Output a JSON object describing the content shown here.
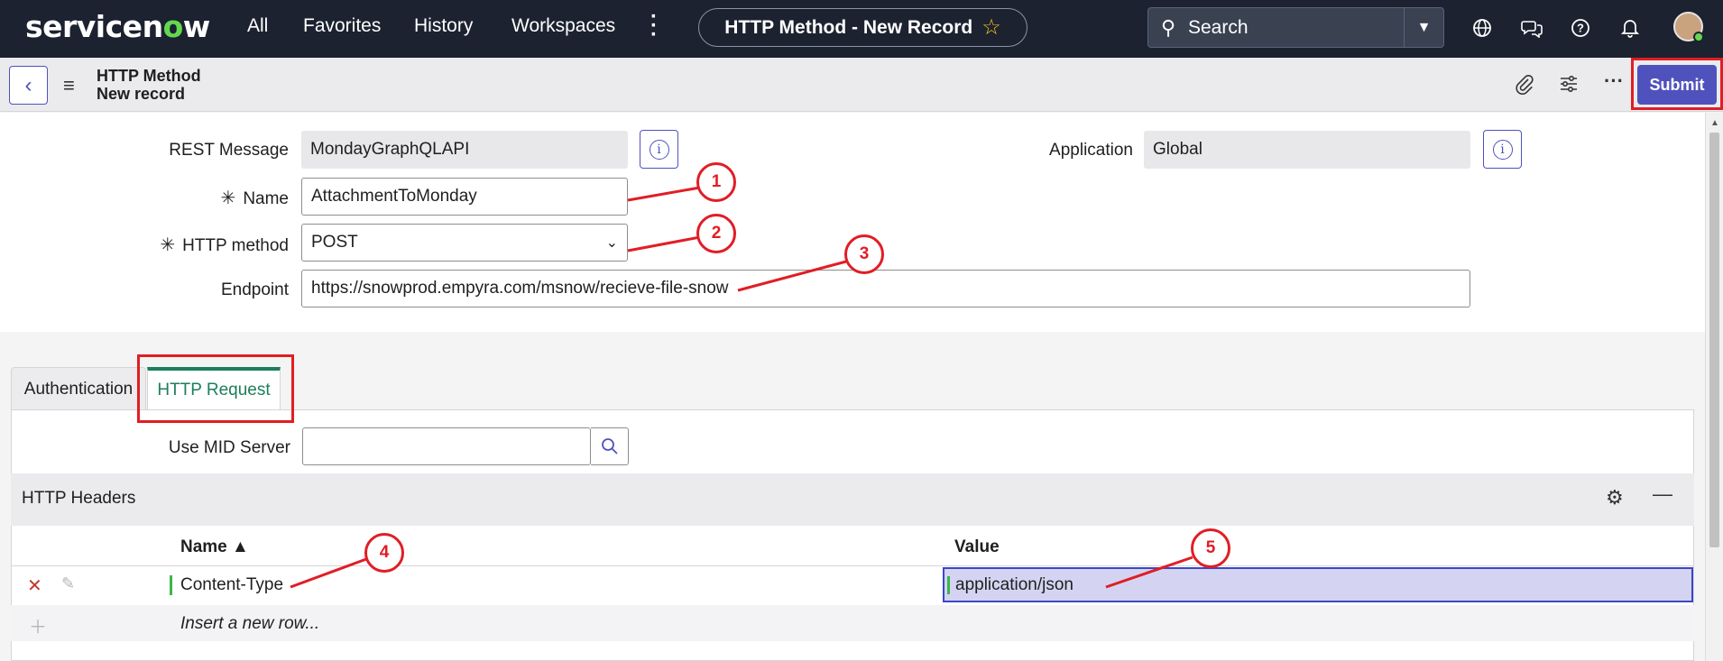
{
  "topnav": {
    "logo_pre": "servicen",
    "logo_o": "o",
    "logo_post": "w",
    "items": [
      "All",
      "Favorites",
      "History",
      "Workspaces"
    ],
    "record_title": "HTTP Method - New Record",
    "star": "☆",
    "search_placeholder": "Search"
  },
  "formbar": {
    "title": "HTTP Method",
    "subtitle": "New record",
    "submit_label": "Submit"
  },
  "form": {
    "rest_message_label": "REST Message",
    "rest_message_value": "MondayGraphQLAPI",
    "application_label": "Application",
    "application_value": "Global",
    "name_label": "Name",
    "name_value": "AttachmentToMonday",
    "http_method_label": "HTTP method",
    "http_method_value": "POST",
    "endpoint_label": "Endpoint",
    "endpoint_value": "https://snowprod.empyra.com/msnow/recieve-file-snow",
    "required_mark": "✳"
  },
  "tabs": [
    "Authentication",
    "HTTP Request"
  ],
  "http_request": {
    "mid_server_label": "Use MID Server",
    "mid_server_value": ""
  },
  "headers": {
    "title": "HTTP Headers",
    "columns": [
      "Name ▲",
      "Value"
    ],
    "rows": [
      {
        "name": "Content-Type",
        "value": "application/json"
      }
    ],
    "insert_text": "Insert a new row..."
  },
  "callouts": [
    "1",
    "2",
    "3",
    "4",
    "5"
  ],
  "colors": {
    "nav_bg": "#1c2230",
    "accent": "#4f52bd",
    "tab_active": "#1e7e5a",
    "annotation": "#e11d25"
  }
}
